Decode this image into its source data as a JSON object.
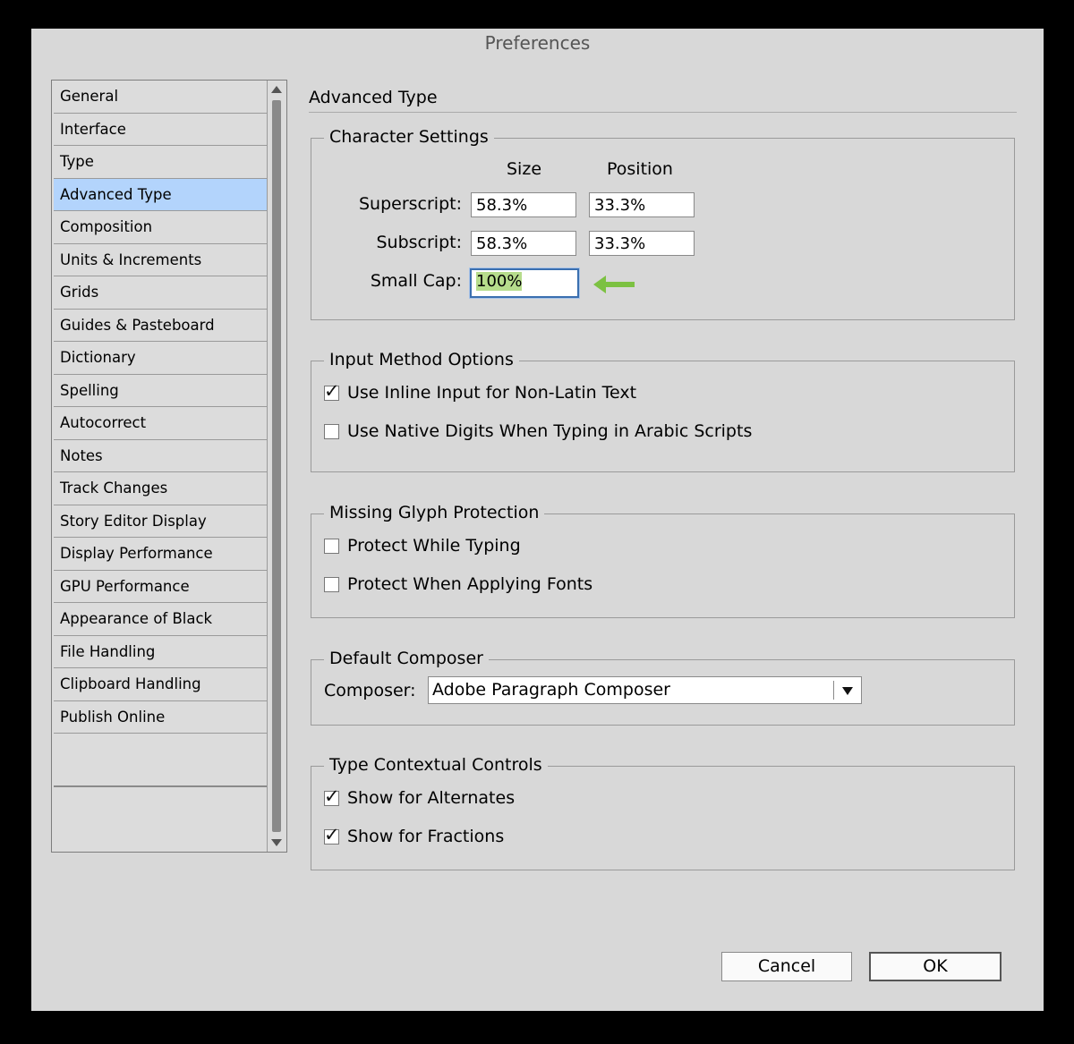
{
  "window": {
    "title": "Preferences"
  },
  "sidebar": {
    "items": [
      {
        "label": "General"
      },
      {
        "label": "Interface"
      },
      {
        "label": "Type"
      },
      {
        "label": "Advanced Type",
        "selected": true
      },
      {
        "label": "Composition"
      },
      {
        "label": "Units & Increments"
      },
      {
        "label": "Grids"
      },
      {
        "label": "Guides & Pasteboard"
      },
      {
        "label": "Dictionary"
      },
      {
        "label": "Spelling"
      },
      {
        "label": "Autocorrect"
      },
      {
        "label": "Notes"
      },
      {
        "label": "Track Changes"
      },
      {
        "label": "Story Editor Display"
      },
      {
        "label": "Display Performance"
      },
      {
        "label": "GPU Performance"
      },
      {
        "label": "Appearance of Black"
      },
      {
        "label": "File Handling"
      },
      {
        "label": "Clipboard Handling"
      },
      {
        "label": "Publish Online"
      }
    ]
  },
  "panel": {
    "title": "Advanced Type",
    "character_settings": {
      "title": "Character Settings",
      "size_header": "Size",
      "position_header": "Position",
      "superscript_label": "Superscript:",
      "superscript_size": "58.3%",
      "superscript_position": "33.3%",
      "subscript_label": "Subscript:",
      "subscript_size": "58.3%",
      "subscript_position": "33.3%",
      "smallcap_label": "Small Cap:",
      "smallcap_value": "100%"
    },
    "input_method": {
      "title": "Input Method Options",
      "inline_input": {
        "label": "Use Inline Input for Non-Latin Text",
        "checked": true
      },
      "native_digits": {
        "label": "Use Native Digits When Typing in Arabic Scripts",
        "checked": false
      }
    },
    "missing_glyph": {
      "title": "Missing Glyph Protection",
      "while_typing": {
        "label": "Protect While Typing",
        "checked": false
      },
      "applying_fonts": {
        "label": "Protect When Applying Fonts",
        "checked": false
      }
    },
    "default_composer": {
      "title": "Default Composer",
      "label": "Composer:",
      "value": "Adobe Paragraph Composer"
    },
    "contextual_controls": {
      "title": "Type Contextual Controls",
      "alternates": {
        "label": "Show for Alternates",
        "checked": true
      },
      "fractions": {
        "label": "Show for Fractions",
        "checked": true
      }
    }
  },
  "buttons": {
    "cancel": "Cancel",
    "ok": "OK"
  },
  "colors": {
    "selection": "#b3d4fc",
    "arrow": "#7cc142",
    "highlight": "#b6dc8c",
    "focus": "#3a6fb0"
  },
  "icons": {
    "checkmark": "check-icon",
    "arrow": "left-arrow-icon",
    "dropdown": "chevron-down-icon"
  }
}
